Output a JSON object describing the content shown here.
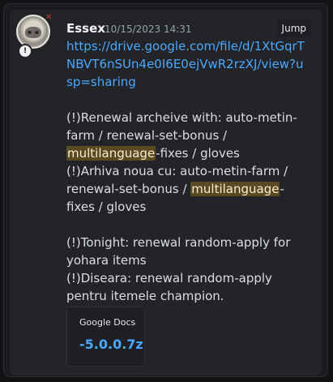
{
  "message": {
    "author": "Essex",
    "timestamp": "10/15/2023 14:31",
    "jump_label": "Jump",
    "link_url": "https://drive.google.com/file/d/1XtGqrTNBVT6nSUn4e0I6E0ejVwR2rzXJ/view?usp=sharing",
    "line1_pre": "(!)Renewal archeive with: auto-metin-farm / renewal-set-bonus / ",
    "line1_hl": "multilanguage",
    "line1_post": "-fixes / gloves",
    "line2_pre": "(!)Arhiva noua cu: auto-metin-farm / renewal-set-bonus / ",
    "line2_hl": "multilanguage",
    "line2_post": "-fixes / gloves",
    "line3": "(!)Tonight: renewal random-apply for yohara items",
    "line4": "(!)Diseara: renewal random-apply pentru itemele champion.",
    "avatar_badge": "!"
  },
  "embed": {
    "provider": "Google Docs",
    "title": "-5.0.0.7z"
  },
  "icons": {
    "avatar": "avatar-image-icon",
    "badge": "status-badge-icon"
  },
  "colors": {
    "link": "#4aa8ff",
    "highlight_bg": "#5a4a22",
    "background": "#1a1b1e"
  }
}
